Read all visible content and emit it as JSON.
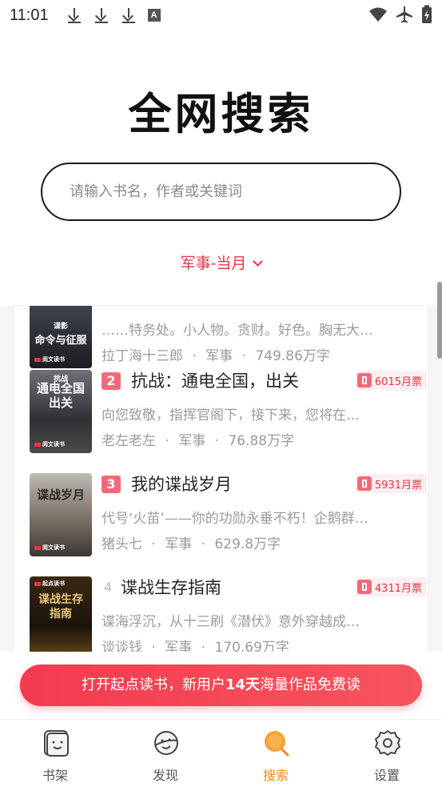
{
  "status_bar": {
    "time": "11:01",
    "icons": [
      "download-icon",
      "download-icon",
      "download-icon",
      "a-icon",
      "wifi-icon",
      "airplane-icon",
      "battery-charging-icon"
    ],
    "a_letter": "A"
  },
  "header": {
    "title": "全网搜索"
  },
  "search": {
    "placeholder": "请输入书名，作者或关键词"
  },
  "filter": {
    "label": "军事-当月"
  },
  "books": [
    {
      "rank": "",
      "title": "",
      "desc": "……特务处。小人物。贪财。好色。胸无大…",
      "author": "拉丁海十三郎",
      "category": "军事",
      "words": "749.86万字",
      "cover_title": "命令与征服",
      "cover_sub": "谍影",
      "cover_pub": "阅文读书"
    },
    {
      "rank": "2",
      "title": "抗战：通电全国，出关",
      "tickets": "6015月票",
      "desc": "向您致敬，指挥官阁下，接下来，您将在…",
      "author": "老左老左",
      "category": "军事",
      "words": "76.88万字",
      "cover_title": "通电全国 出关",
      "cover_sub": "抗战",
      "cover_pub": "阅文读书"
    },
    {
      "rank": "3",
      "title": "我的谍战岁月",
      "tickets": "5931月票",
      "desc": "代号‘火苗’——你的功勋永垂不朽！企鹅群…",
      "author": "猪头七",
      "category": "军事",
      "words": "629.8万字",
      "cover_title": "谍战岁月",
      "cover_sub": "",
      "cover_pub": "阅文读书"
    },
    {
      "rank": "4",
      "title": "谍战生存指南",
      "tickets": "4311月票",
      "desc": "谍海浮沉，从十三刷《潜伏》意外穿越成…",
      "author": "谈谈钱",
      "category": "军事",
      "words": "170.69万字",
      "cover_title": "谍战生存指南",
      "cover_sub": "",
      "cover_pub": "起点读书"
    }
  ],
  "meta_separator": "·",
  "cta": {
    "part1": "打开起点读书，新用户",
    "highlight": "14天",
    "part2": "海量作品免费读"
  },
  "tabs": [
    {
      "label": "书架",
      "icon": "bookshelf-icon",
      "active": false
    },
    {
      "label": "发现",
      "icon": "discover-planet-icon",
      "active": false
    },
    {
      "label": "搜索",
      "icon": "search-icon",
      "active": true
    },
    {
      "label": "设置",
      "icon": "settings-gear-icon",
      "active": false
    }
  ],
  "colors": {
    "accent_red": "#e53545",
    "rank_badge": "#f26a7a",
    "active_tab": "#f28b17",
    "cta_gradient_start": "#f43b4f",
    "cta_gradient_end": "#f7545f"
  }
}
